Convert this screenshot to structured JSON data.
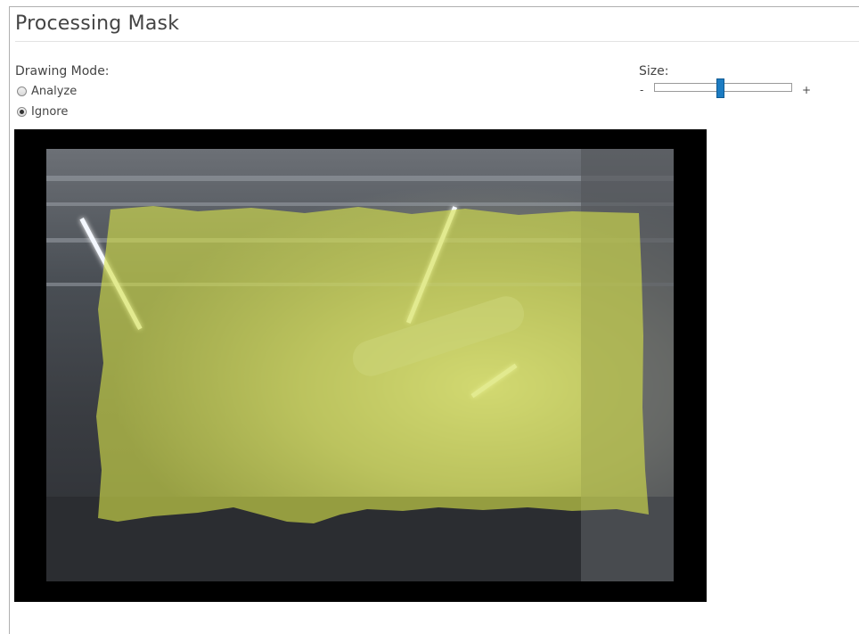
{
  "header": {
    "title": "Processing Mask"
  },
  "drawing_mode": {
    "label": "Drawing Mode:",
    "options": [
      {
        "label": "Analyze",
        "selected": false
      },
      {
        "label": "Ignore",
        "selected": true
      }
    ]
  },
  "size": {
    "label": "Size:",
    "minus": "-",
    "plus": "+",
    "value_fraction": 0.48
  },
  "colors": {
    "mask": "#d7e24a",
    "slider_thumb": "#1c7cc2"
  }
}
